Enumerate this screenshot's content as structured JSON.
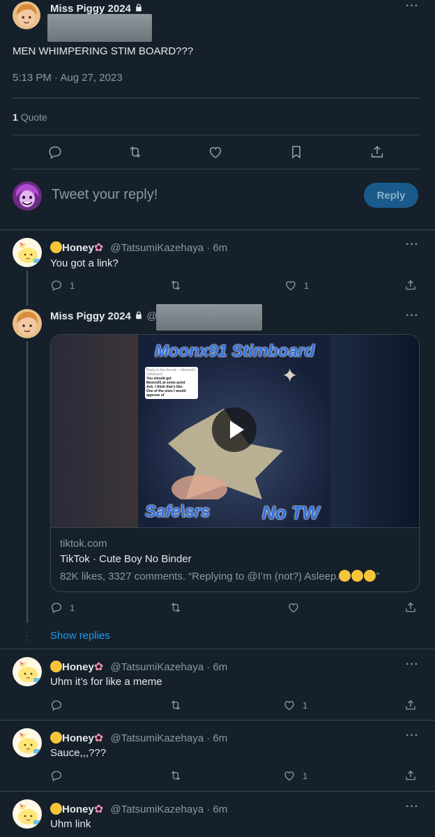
{
  "main_tweet": {
    "author": "Miss Piggy 2024",
    "text": "MEN WHIMPERING STIM BOARD???",
    "timestamp": "5:13 PM · Aug 27, 2023",
    "quote_count": "1",
    "quote_label": "Quote"
  },
  "composer": {
    "placeholder": "Tweet your reply!",
    "reply_button": "Reply"
  },
  "thread": [
    {
      "author": "Honey",
      "handle": "@TatsumiKazehaya",
      "time": "· 6m",
      "text": "You got a link?",
      "replies": "1",
      "likes": "1"
    },
    {
      "author": "Miss Piggy 2024",
      "handle": "@",
      "card": {
        "title_overlay": "Moonx91 Stimboard",
        "bottom_left": "Safe\\srs",
        "bottom_right": "No TW",
        "caption_lines": [
          "Reply to the thread — Moonx91 Stimboard",
          "You should get",
          "Moonx91 at some point",
          "Ash. I think that's like-",
          "One of the ones I would",
          "approve of"
        ],
        "domain": "tiktok.com",
        "title": "TikTok · Cute Boy No Binder",
        "description": "82K likes, 3327 comments. “Replying to @I’m (not?) Asleep."
      },
      "replies": "1",
      "show_replies": "Show replies"
    }
  ],
  "replies": [
    {
      "author": "Honey",
      "handle": "@TatsumiKazehaya",
      "time": "· 6m",
      "text": "Uhm it’s for like a meme",
      "likes": "1"
    },
    {
      "author": "Honey",
      "handle": "@TatsumiKazehaya",
      "time": "· 6m",
      "text": "Sauce,,,???",
      "likes": "1"
    },
    {
      "author": "Honey",
      "handle": "@TatsumiKazehaya",
      "time": "· 6m",
      "text": "Uhm link"
    }
  ],
  "colors": {
    "background": "#15202b",
    "accent": "#1d9bf0",
    "reply_button": "#1a5a8a",
    "muted": "#8b98a5"
  }
}
